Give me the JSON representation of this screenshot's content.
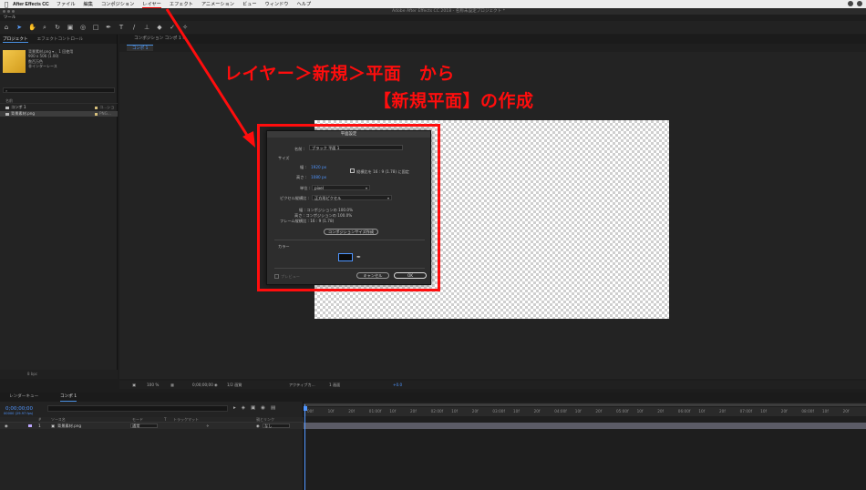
{
  "menubar": {
    "app": "After Effects CC",
    "items": [
      "ファイル",
      "編集",
      "コンポジション",
      "レイヤー",
      "エフェクト",
      "アニメーション",
      "ビュー",
      "ウィンドウ",
      "ヘルプ"
    ],
    "active_item": "レイヤー"
  },
  "window_title": "Adobe After Effects CC 2018 - 名称未設定プロジェクト *",
  "tools_label": "ツール",
  "project_panel": {
    "tabs": [
      "プロジェクト",
      "エフェクトコントロール"
    ],
    "asset_info": [
      "背景素材.png ▾ 、1 回使用",
      "900 x 506 (1.00)",
      "",
      "数百万色",
      "非インターレース"
    ],
    "search_placeholder": "",
    "col_header": "名前",
    "items": [
      {
        "name": "コンポ 1",
        "type": "コ...ション"
      },
      {
        "name": "背景素材.png",
        "type": "PNG..."
      }
    ],
    "bpc": "8 bpc"
  },
  "comp_panel": {
    "tab": "コンポジション コンポ 1 ≡",
    "subtab": "コンポ 1"
  },
  "annotation": {
    "line1": "レイヤー＞新規＞平面　から",
    "line2": "【新規平面】の作成",
    "color": "#ff0d0d"
  },
  "dialog": {
    "title": "平面設定",
    "name_label": "名前 :",
    "name_value": "ブラック 平面 1",
    "size_section": "サイズ",
    "width_label": "幅 :",
    "width_value": "1920 px",
    "height_label": "高さ :",
    "height_value": "1080 px",
    "lock_aspect": "縦横比を 16 : 9 (1.78) に固定",
    "units_label": "単位 :",
    "units_value": "pixel",
    "pixel_aspect_label": "ピクセル縦横比 :",
    "pixel_aspect_value": "正方形ピクセル",
    "info_width": "幅 : コンポジションの 100.0%",
    "info_height": "高さ : コンポジションの 100.0%",
    "info_frame": "フレーム縦横比 : 16 : 9 (1.78)",
    "make_comp_size": "コンポジションサイズ作成",
    "color_section": "カラー",
    "preview": "プレビュー",
    "cancel": "キャンセル",
    "ok": "OK",
    "color_value": "#0b0b0b"
  },
  "viewer_bar": {
    "zoom": "100 %",
    "timecode": "0;00;00;00",
    "resolution": "1/2 画質",
    "camera": "アクティブカ...",
    "views": "1 画面",
    "exposure": "+0.0"
  },
  "timeline": {
    "tabs": [
      "レンダーキュー",
      "コンポ 1"
    ],
    "timecode": "0;00;00;00",
    "timecode_sub": "00000 (29.97 fps)",
    "headers": [
      "#",
      "ソース名",
      "モード",
      "T",
      "トラックマット",
      "親とリンク"
    ],
    "layer": {
      "index": "1",
      "name": "背景素材.png",
      "mode": "通常",
      "parent": "なし"
    },
    "ruler_labels": [
      "00f",
      "10f",
      "20f",
      "01:00f",
      "10f",
      "20f",
      "02:00f",
      "10f",
      "20f",
      "03:00f",
      "10f",
      "20f",
      "04:00f",
      "10f",
      "20f",
      "05:00f",
      "10f",
      "20f",
      "06:00f",
      "10f",
      "20f",
      "07:00f",
      "10f",
      "20f",
      "08:00f",
      "10f",
      "20f"
    ]
  }
}
